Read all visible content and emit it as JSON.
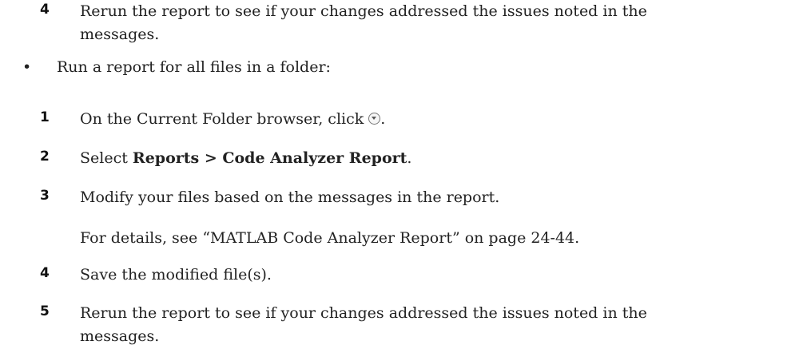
{
  "top_step": {
    "number": "4",
    "text_line1": "Rerun the report to see if your changes addressed the issues noted in the",
    "text_line2": "messages."
  },
  "bullet": {
    "symbol": "•",
    "text": "Run a report for all files in a folder:"
  },
  "steps": [
    {
      "number": "1",
      "text_before_icon": "On the Current Folder browser, click ",
      "icon": "actions-dropdown-icon",
      "text_after_icon": "."
    },
    {
      "number": "2",
      "text_prefix": "Select ",
      "bold_part": "Reports > Code Analyzer Report",
      "text_suffix": "."
    },
    {
      "number": "3",
      "text": "Modify your files based on the messages in the report."
    },
    {
      "number": "4",
      "text": "Save the modified file(s)."
    },
    {
      "number": "5",
      "text_line1": "Rerun the report to see if your changes addressed the issues noted in the",
      "text_line2": "messages."
    }
  ],
  "note": "For details, see “MATLAB Code Analyzer Report” on page 24-44."
}
